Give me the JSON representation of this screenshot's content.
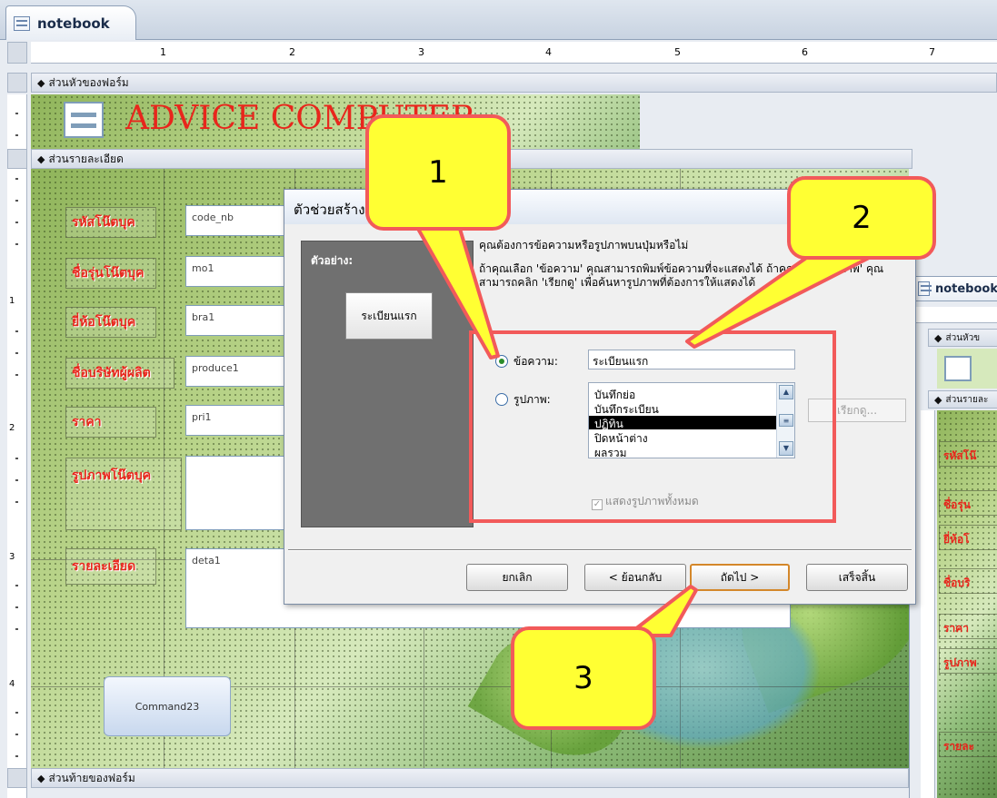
{
  "tab": {
    "title": "notebook"
  },
  "ruler": {
    "numbers": [
      "1",
      "2",
      "3",
      "4",
      "5",
      "6",
      "7"
    ],
    "vnumbers": [
      "1",
      "2",
      "3",
      "4"
    ]
  },
  "sections": {
    "header": "ส่วนหัวของฟอร์ม",
    "detail": "ส่วนรายละเอียด",
    "footer": "ส่วนท้ายของฟอร์ม"
  },
  "form": {
    "banner_text": "ADVICE COMPUTER",
    "labels": [
      "รหัสโน๊ตบุค",
      "ชื่อรุ่นโน๊ตบุค",
      "ยี่ห้อโน๊ตบุค",
      "ชื่อบริษัทผู้ผลิต",
      "ราคา",
      "รูปภาพโน๊ตบุค",
      "รายละเอียด"
    ],
    "fields": [
      "code_nb",
      "mo1",
      "bra1",
      "produce1",
      "pri1",
      "",
      "deta1"
    ],
    "command_button": "Command23"
  },
  "dialog": {
    "title": "ตัวช่วยสร้างปุ่มคำสั่ง",
    "preview_title": "ตัวอย่าง:",
    "preview_button": "ระเบียนแรก",
    "question": "คุณต้องการข้อความหรือรูปภาพบนปุ่มหรือไม่",
    "explain": "ถ้าคุณเลือก 'ข้อความ' คุณสามารถพิมพ์ข้อความที่จะแสดงได้ ถ้าคุณเลือก 'รูปภาพ' คุณสามารถคลิก 'เรียกดู' เพื่อค้นหารูปภาพที่ต้องการให้แสดงได้",
    "text_option": "ข้อความ:",
    "picture_option": "รูปภาพ:",
    "text_value": "ระเบียนแรก",
    "picture_list": [
      "บันทึกย่อ",
      "บันทึกระเบียน",
      "ปฏิทิน",
      "ปิดหน้าต่าง",
      "ผลรวม"
    ],
    "picture_selected_index": 2,
    "browse_label": "เรียกดู...",
    "show_all_label": "แสดงรูปภาพทั้งหมด",
    "buttons": {
      "cancel": "ยกเลิก",
      "back": "< ย้อนกลับ",
      "next": "ถัดไป >",
      "finish": "เสร็จสิ้น"
    }
  },
  "callouts": [
    "1",
    "2",
    "3"
  ],
  "window2": {
    "tab_title": "notebook",
    "section_header": "ส่วนหัวข",
    "section_detail": "ส่วนรายละ",
    "labels": [
      "รหัสโน๊",
      "ชื่อรุ่น",
      "ยี่ห้อโ",
      "ชื่อบริ",
      "ราคา",
      "รูปภาพ",
      "รายละ"
    ]
  },
  "colors": {
    "callout_fill": "#ffff33",
    "callout_border": "#f25a5a",
    "label_red": "#e8261c"
  }
}
